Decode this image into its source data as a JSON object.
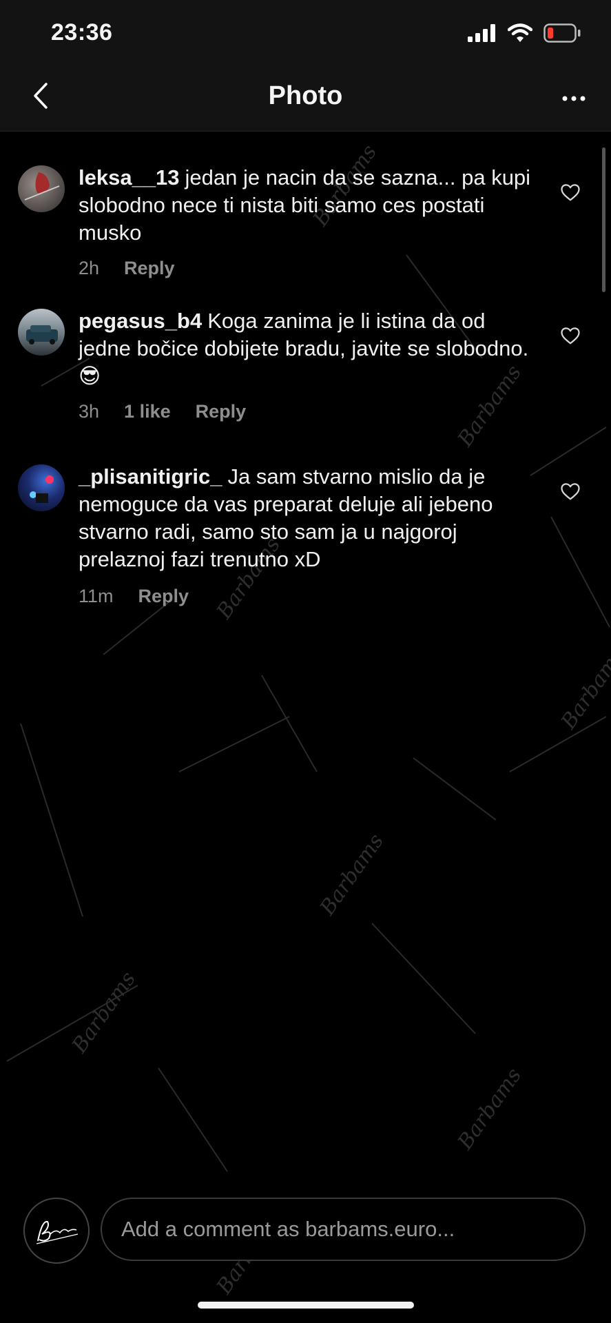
{
  "status_bar": {
    "time": "23:36"
  },
  "nav": {
    "title": "Photo"
  },
  "comments": [
    {
      "username": "leksa__13",
      "text": "jedan je nacin da se sazna... pa kupi slobodno nece ti nista biti samo ces postati musko",
      "time": "2h",
      "likes": "",
      "reply_label": "Reply"
    },
    {
      "username": "pegasus_b4",
      "text": "Koga zanima je li istina da od jedne bočice dobijete bradu, javite se slobodno.😎",
      "time": "3h",
      "likes": "1 like",
      "reply_label": "Reply"
    },
    {
      "username": "_plisanitigric_",
      "text": "Ja sam stvarno mislio da je nemoguce da vas preparat deluje ali jebeno stvarno radi, samo sto sam ja u najgoroj prelaznoj fazi trenutno xD",
      "time": "11m",
      "likes": "",
      "reply_label": "Reply"
    }
  ],
  "composer": {
    "placeholder": "Add a comment as barbams.euro..."
  },
  "watermark": {
    "text": "Barbams"
  },
  "colors": {
    "background": "#000000",
    "bar": "#131313",
    "muted": "#8e8e8e",
    "battery_low": "#ff3b30"
  }
}
